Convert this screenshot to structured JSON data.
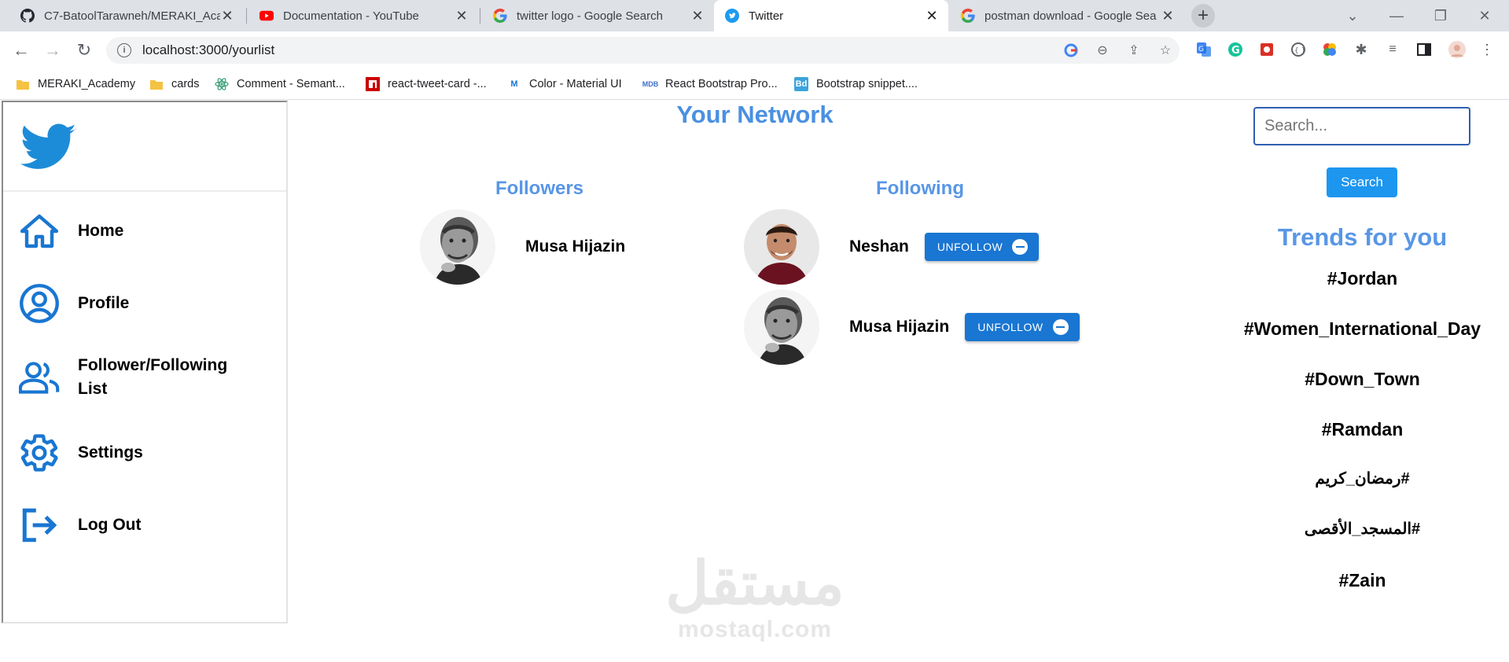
{
  "browser": {
    "tabs": [
      {
        "title": "C7-BatoolTarawneh/MERAKI_Aca",
        "icon": "github-icon"
      },
      {
        "title": "Documentation - YouTube",
        "icon": "youtube-icon"
      },
      {
        "title": "twitter logo - Google Search",
        "icon": "google-icon"
      },
      {
        "title": "Twitter",
        "icon": "twitter-icon",
        "active": true
      },
      {
        "title": "postman download - Google Sea",
        "icon": "google-icon"
      }
    ],
    "url": "localhost:3000/yourlist",
    "bookmarks": [
      {
        "label": "MERAKI_Academy",
        "icon": "folder-icon"
      },
      {
        "label": "cards",
        "icon": "folder-icon"
      },
      {
        "label": "Comment - Semant...",
        "icon": "react-icon"
      },
      {
        "label": "react-tweet-card -...",
        "icon": "npm-icon"
      },
      {
        "label": "Color - Material UI",
        "icon": "mui-icon"
      },
      {
        "label": "React Bootstrap Pro...",
        "icon": "mdb-icon"
      },
      {
        "label": "Bootstrap snippet....",
        "icon": "bd-icon"
      }
    ]
  },
  "sidebar": {
    "items": [
      {
        "label": "Home",
        "icon": "home-icon"
      },
      {
        "label": "Profile",
        "icon": "profile-icon"
      },
      {
        "label": "Follower/Following List",
        "icon": "people-icon"
      },
      {
        "label": "Settings",
        "icon": "gear-icon"
      },
      {
        "label": "Log Out",
        "icon": "logout-icon"
      }
    ]
  },
  "main": {
    "title": "Your Network",
    "followers_title": "Followers",
    "following_title": "Following",
    "followers": [
      {
        "name": "Musa Hijazin"
      }
    ],
    "following": [
      {
        "name": "Neshan",
        "button": "UNFOLLOW"
      },
      {
        "name": "Musa Hijazin",
        "button": "UNFOLLOW"
      }
    ]
  },
  "right": {
    "search_placeholder": "Search...",
    "search_button": "Search",
    "trends_title": "Trends for you",
    "trends": [
      "#Jordan",
      "#Women_International_Day",
      "#Down_Town",
      "#Ramdan",
      "#رمضان_كريم",
      "#المسجد_الأقصى",
      "#Zain"
    ]
  },
  "watermark": {
    "arabic": "مستقل",
    "latin": "mostaql.com"
  },
  "colors": {
    "accent": "#1976d2",
    "heading": "#5896e6",
    "twitter": "#1d9bf0"
  }
}
